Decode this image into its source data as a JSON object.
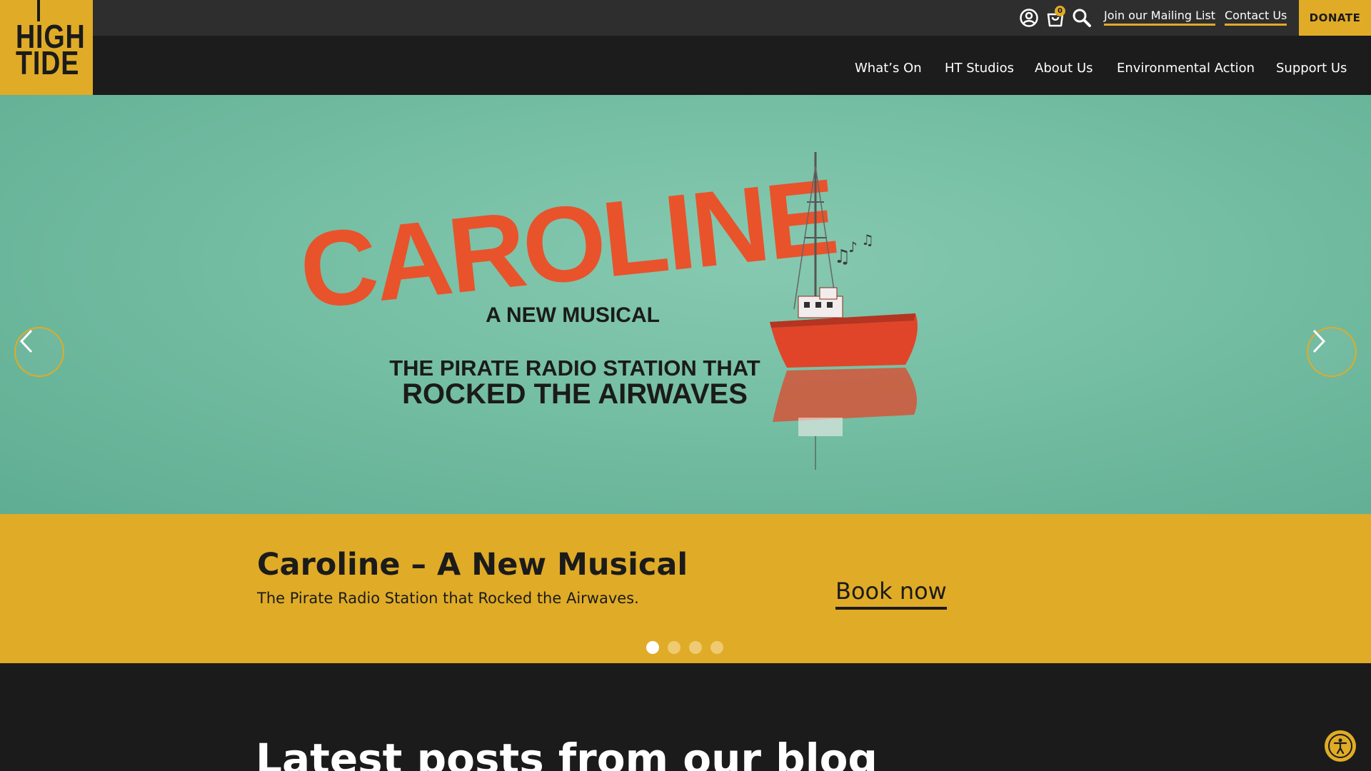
{
  "header": {
    "logo": {
      "line1": "HIGH",
      "line2": "TIDE"
    },
    "cart_count": "0",
    "utility_links": [
      "Join our Mailing List",
      "Contact Us"
    ],
    "donate_label": "DONATE",
    "nav": [
      "What’s On",
      "HT Studios",
      "About Us",
      "Environmental Action",
      "Support Us"
    ]
  },
  "hero": {
    "artwork": {
      "title": "CAROLINE",
      "subtitle": "A NEW MUSICAL",
      "tagline_line1": "THE PIRATE RADIO STATION THAT",
      "tagline_line2": "ROCKED THE AIRWAVES"
    }
  },
  "caption": {
    "title": "Caroline – A New Musical",
    "subtitle": "The Pirate Radio Station that Rocked the Airwaves.",
    "cta_label": "Book now",
    "slide_count": 4,
    "active_slide": 1
  },
  "blog": {
    "heading": "Latest posts from our blog"
  },
  "colors": {
    "accent": "#e0ab26",
    "dark": "#1b1b1b",
    "hero_teal": "#74bea3",
    "ship_red": "#e0452a"
  },
  "icons": [
    "user-icon",
    "basket-icon",
    "search-icon",
    "chevron-left-icon",
    "chevron-right-icon",
    "accessibility-icon"
  ]
}
